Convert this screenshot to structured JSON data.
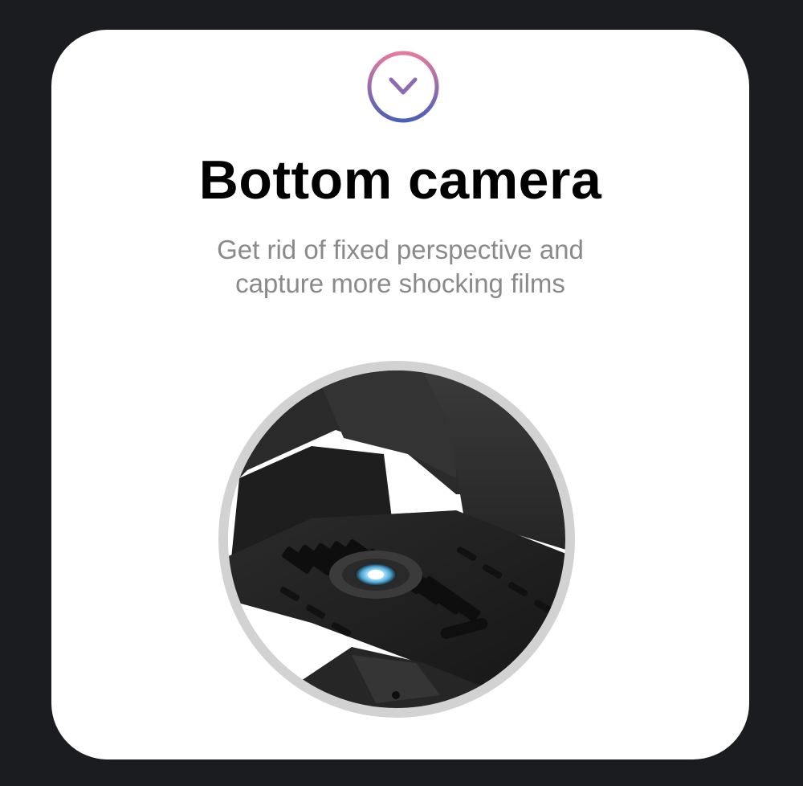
{
  "card": {
    "icon": "chevron-down-circle-icon",
    "title": "Bottom camera",
    "subtitle_line1": "Get rid of fixed perspective and",
    "subtitle_line2": "capture more shocking films"
  },
  "colors": {
    "background": "#1b1c20",
    "card": "#ffffff",
    "title": "#000000",
    "subtitle": "#8a8a8a",
    "icon_gradient_top": "#e57aa0",
    "icon_gradient_bottom": "#4b5fb8",
    "photo_ring": "#d2d2d2"
  },
  "photo": {
    "subject": "drone-bottom-camera-image"
  }
}
